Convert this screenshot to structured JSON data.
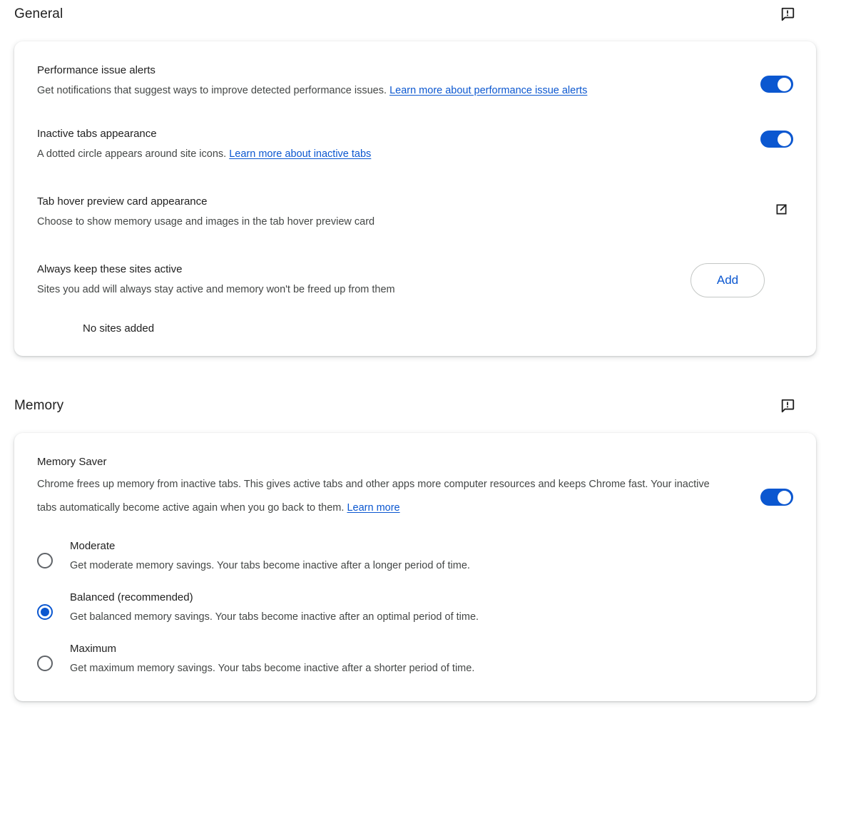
{
  "colors": {
    "accent": "#0b57d0",
    "link": "#0b57d0",
    "title_text": "#1f1f1f",
    "body_text": "#444746",
    "card_bg": "#ffffff",
    "page_bg": "#ffffff",
    "radio_unselected_border": "#5f6368"
  },
  "sections": [
    {
      "title": "General",
      "header_icon": "feedback-icon",
      "rows": [
        {
          "title": "Performance issue alerts",
          "description": "Get notifications that suggest ways to improve detected performance issues. ",
          "link_text": "Learn more about performance issue alerts",
          "control": "toggle",
          "toggle_on": true
        },
        {
          "title": "Inactive tabs appearance",
          "description": "A dotted circle appears around site icons. ",
          "link_text": "Learn more about inactive tabs",
          "control": "toggle",
          "toggle_on": true
        },
        {
          "title": "Tab hover preview card appearance",
          "description": "Choose to show memory usage and images in the tab hover preview card",
          "link_text": "",
          "control": "external-link-icon"
        },
        {
          "title": "Always keep these sites active",
          "description": "Sites you add will always stay active and memory won't be freed up from them",
          "link_text": "",
          "control": "button",
          "button_label": "Add"
        }
      ],
      "empty_state": "No sites added"
    },
    {
      "title": "Memory",
      "header_icon": "feedback-icon",
      "memory_saver": {
        "title": "Memory Saver",
        "description": "Chrome frees up memory from inactive tabs. This gives active tabs and other apps more computer resources and keeps Chrome fast. Your inactive tabs automatically become active again when you go back to them. ",
        "link_text": "Learn more",
        "toggle_on": true
      },
      "radio_options": [
        {
          "label": "Moderate",
          "description": "Get moderate memory savings. Your tabs become inactive after a longer period of time.",
          "selected": false
        },
        {
          "label": "Balanced (recommended)",
          "description": "Get balanced memory savings. Your tabs become inactive after an optimal period of time.",
          "selected": true
        },
        {
          "label": "Maximum",
          "description": "Get maximum memory savings. Your tabs become inactive after a shorter period of time.",
          "selected": false
        }
      ]
    }
  ]
}
